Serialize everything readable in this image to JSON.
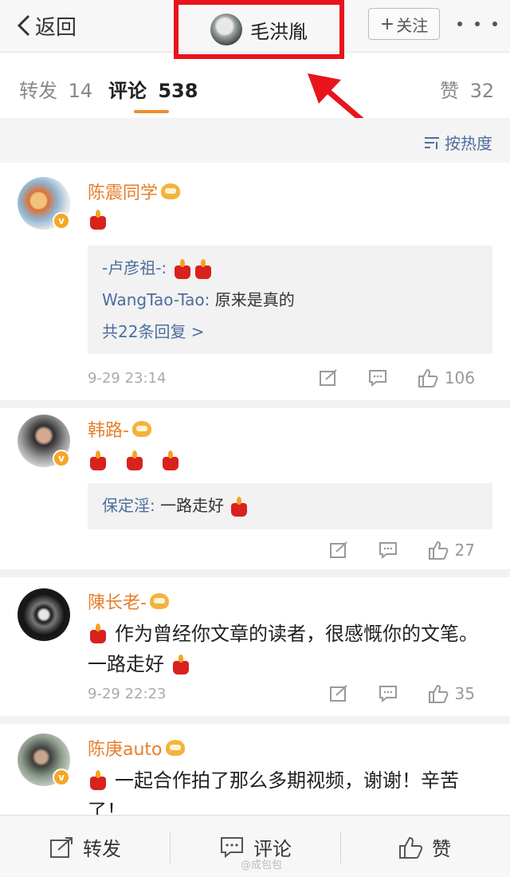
{
  "header": {
    "back_label": "返回",
    "author_name": "毛洪胤",
    "follow_label": "关注",
    "follow_prefix": "+"
  },
  "tabs": [
    {
      "label": "转发",
      "count": "14"
    },
    {
      "label": "评论",
      "count": "538"
    },
    {
      "label": "赞",
      "count": "32"
    }
  ],
  "sort_label": "按热度",
  "comments": [
    {
      "user": "陈震同学",
      "text": "",
      "replies": [
        {
          "name": "-卢彦祖-:",
          "text": ""
        },
        {
          "name": "WangTao-Tao:",
          "text": " 原来是真的"
        }
      ],
      "more_replies": "共22条回复 >",
      "time": "9-29 23:14",
      "likes": "106"
    },
    {
      "user": "韩路-",
      "text": "",
      "replies": [
        {
          "name": "保定淫:",
          "text": " 一路走好"
        }
      ],
      "time": "",
      "likes": "27"
    },
    {
      "user": "陳长老-",
      "text": "作为曾经你文章的读者，很感慨你的文笔。一路走好",
      "time": "9-29 22:23",
      "likes": "35"
    },
    {
      "user": "陈庚auto",
      "text": " 一起合作拍了那么多期视频，谢谢！辛苦了！"
    }
  ],
  "bottom": {
    "repost_label": "转发",
    "comment_label": "评论",
    "like_label": "赞"
  },
  "watermark": "@成包包",
  "colors": {
    "accent_orange": "#e67f2c",
    "link_blue": "#4d6e9e",
    "highlight_red": "#e8141b"
  }
}
